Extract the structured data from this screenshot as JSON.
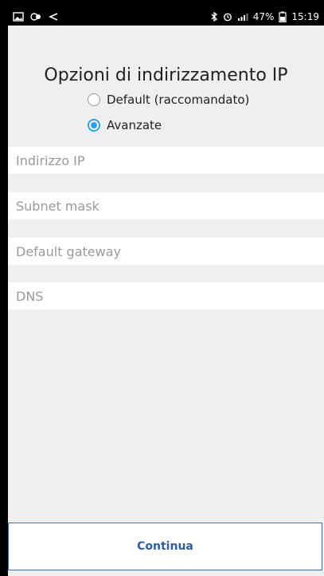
{
  "statusbar": {
    "battery": "47%",
    "time": "15:19",
    "left_icons": [
      "image-icon",
      "notification-icon",
      "back-arrow-icon"
    ],
    "right_icons": [
      "bluetooth-icon",
      "alarm-icon",
      "signal-icon",
      "battery-icon"
    ]
  },
  "main": {
    "title": "Opzioni di indirizzamento IP",
    "options": [
      {
        "label": "Default (raccomandato)",
        "selected": false
      },
      {
        "label": "Avanzate",
        "selected": true
      }
    ],
    "fields": [
      {
        "placeholder": "Indirizzo IP",
        "value": ""
      },
      {
        "placeholder": "Subnet mask",
        "value": ""
      },
      {
        "placeholder": "Default gateway",
        "value": ""
      },
      {
        "placeholder": "DNS",
        "value": ""
      }
    ]
  },
  "footer": {
    "continue_label": "Continua"
  },
  "colors": {
    "accent": "#2ea1e8",
    "button_text": "#2f5e9d",
    "background": "#efefef"
  }
}
